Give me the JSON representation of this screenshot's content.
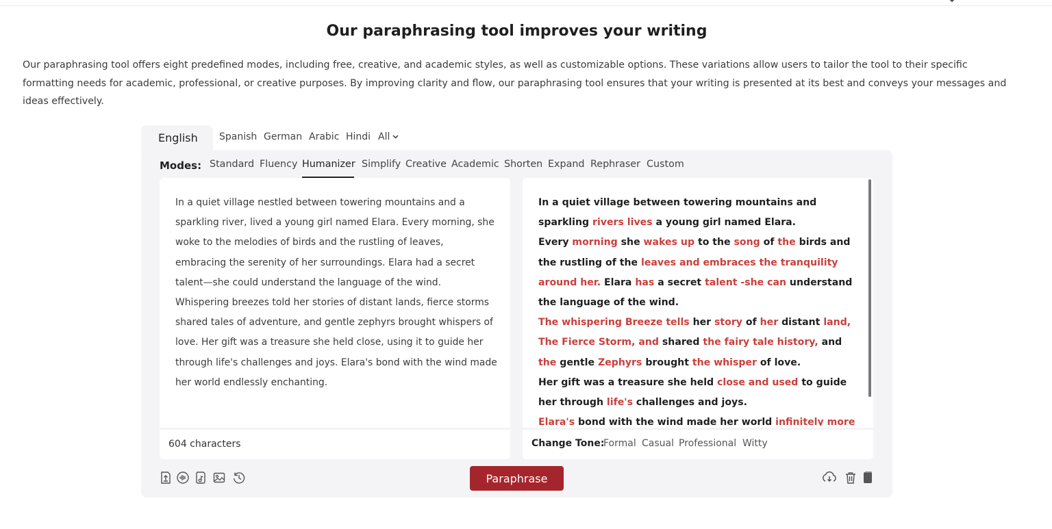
{
  "heading": "Our paraphrasing tool improves your writing",
  "intro": "Our paraphrasing tool offers eight predefined modes, including free, creative, and academic styles, as well as customizable options. These variations allow users to tailor the tool to their specific formatting needs for academic, professional, or creative purposes. By improving clarity and flow, our paraphrasing tool ensures that your writing is presented at its best and conveys your messages and ideas effectively.",
  "languages": [
    "English",
    "Spanish",
    "German",
    "Arabic",
    "Hindi",
    "All"
  ],
  "modes_label": "Modes:",
  "modes": [
    "Standard",
    "Fluency",
    "Humanizer",
    "Simplify",
    "Creative",
    "Academic",
    "Shorten",
    "Expand",
    "Rephraser",
    "Custom"
  ],
  "active_mode": "Humanizer",
  "input": {
    "text": "In a quiet village nestled between towering mountains and a sparkling river, lived a young girl named Elara. Every morning, she woke to the melodies of birds and the rustling of leaves, embracing the serenity of her surroundings. Elara had a secret talent—she could understand the language of the wind. Whispering breezes told her stories of distant lands, fierce storms shared tales of adventure, and gentle zephyrs brought whispers of love. Her gift was a treasure she held close, using it to guide her through life's challenges and joys. Elara's bond with the wind made her world endlessly enchanting.",
    "char_count": "604 characters"
  },
  "output": {
    "paragraphs": [
      [
        {
          "t": "In a quiet village between towering mountains and sparkling ",
          "h": false
        },
        {
          "t": "rivers lives",
          "h": true
        },
        {
          "t": " a young girl named Elara.",
          "h": false
        }
      ],
      [
        {
          "t": "Every ",
          "h": false
        },
        {
          "t": "morning",
          "h": true
        },
        {
          "t": " she ",
          "h": false
        },
        {
          "t": "wakes up",
          "h": true
        },
        {
          "t": " to the ",
          "h": false
        },
        {
          "t": "song",
          "h": true
        },
        {
          "t": " of ",
          "h": false
        },
        {
          "t": "the",
          "h": true
        },
        {
          "t": " birds and the rustling of the ",
          "h": false
        },
        {
          "t": "leaves and embraces the tranquility around her.",
          "h": true
        },
        {
          "t": " Elara ",
          "h": false
        },
        {
          "t": "has",
          "h": true
        },
        {
          "t": " a secret ",
          "h": false
        },
        {
          "t": "talent -she can",
          "h": true
        },
        {
          "t": " understand the language of the wind.",
          "h": false
        }
      ],
      [
        {
          "t": "The whispering Breeze tells",
          "h": true
        },
        {
          "t": " her ",
          "h": false
        },
        {
          "t": "story",
          "h": true
        },
        {
          "t": " of ",
          "h": false
        },
        {
          "t": "her",
          "h": true
        },
        {
          "t": " distant ",
          "h": false
        },
        {
          "t": "land, The Fierce Storm, and",
          "h": true
        },
        {
          "t": " shared ",
          "h": false
        },
        {
          "t": "the fairy tale history,",
          "h": true
        },
        {
          "t": " and ",
          "h": false
        },
        {
          "t": "the",
          "h": true
        },
        {
          "t": " gentle ",
          "h": false
        },
        {
          "t": "Zephyrs",
          "h": true
        },
        {
          "t": " brought ",
          "h": false
        },
        {
          "t": "the whisper",
          "h": true
        },
        {
          "t": " of love.",
          "h": false
        }
      ],
      [
        {
          "t": "Her gift was a treasure she held ",
          "h": false
        },
        {
          "t": "close and used",
          "h": true
        },
        {
          "t": " to guide her through ",
          "h": false
        },
        {
          "t": "life's",
          "h": true
        },
        {
          "t": " challenges and joys.",
          "h": false
        }
      ],
      [
        {
          "t": "Elara's",
          "h": true
        },
        {
          "t": " bond with the wind made her world ",
          "h": false
        },
        {
          "t": "infinitely more",
          "h": true
        }
      ]
    ]
  },
  "tone_label": "Change Tone:",
  "tones": [
    "Formal",
    "Casual",
    "Professional",
    "Witty"
  ],
  "paraphrase_button": "Paraphrase",
  "icons": {
    "left": [
      "upload-file-icon",
      "voice-input-icon",
      "audio-file-icon",
      "image-upload-icon",
      "history-icon"
    ],
    "right": [
      "download-icon",
      "delete-icon",
      "copy-icon"
    ]
  },
  "colors": {
    "accent_button": "#a4262c",
    "highlight_text": "#c9403c",
    "panel_background": "#f4f4f6"
  }
}
